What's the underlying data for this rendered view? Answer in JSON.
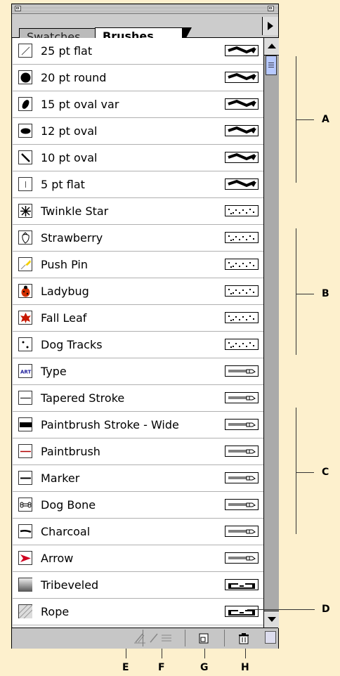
{
  "tabs": [
    {
      "label": "Swatches",
      "active": false
    },
    {
      "label": "Brushes",
      "active": true
    }
  ],
  "brushes": [
    {
      "name": "25 pt flat",
      "type": "calligraphic",
      "icon": "thin-diagonal-stroke-icon"
    },
    {
      "name": "20 pt round",
      "type": "calligraphic",
      "icon": "round-tip-icon"
    },
    {
      "name": "15 pt oval var",
      "type": "calligraphic",
      "icon": "oval-tilted-tip-icon"
    },
    {
      "name": "12 pt oval",
      "type": "calligraphic",
      "icon": "oval-tip-icon"
    },
    {
      "name": "10 pt oval",
      "type": "calligraphic",
      "icon": "diagonal-stroke-icon"
    },
    {
      "name": "5 pt flat",
      "type": "calligraphic",
      "icon": "flat-tip-icon"
    },
    {
      "name": "Twinkle Star",
      "type": "scatter",
      "icon": "star-icon"
    },
    {
      "name": "Strawberry",
      "type": "scatter",
      "icon": "strawberry-icon"
    },
    {
      "name": "Push Pin",
      "type": "scatter",
      "icon": "push-pin-icon"
    },
    {
      "name": "Ladybug",
      "type": "scatter",
      "icon": "ladybug-icon"
    },
    {
      "name": "Fall Leaf",
      "type": "scatter",
      "icon": "leaf-icon"
    },
    {
      "name": "Dog Tracks",
      "type": "scatter",
      "icon": "paw-print-icon"
    },
    {
      "name": "Type",
      "type": "art",
      "icon": "art-text-icon"
    },
    {
      "name": "Tapered Stroke",
      "type": "art",
      "icon": "tapered-stroke-icon"
    },
    {
      "name": "Paintbrush Stroke - Wide",
      "type": "art",
      "icon": "wide-stroke-icon"
    },
    {
      "name": "Paintbrush",
      "type": "art",
      "icon": "paintbrush-stroke-icon"
    },
    {
      "name": "Marker",
      "type": "art",
      "icon": "marker-stroke-icon"
    },
    {
      "name": "Dog Bone",
      "type": "art",
      "icon": "dog-bone-icon"
    },
    {
      "name": "Charcoal",
      "type": "art",
      "icon": "charcoal-stroke-icon"
    },
    {
      "name": "Arrow",
      "type": "art",
      "icon": "arrow-icon"
    },
    {
      "name": "Tribeveled",
      "type": "pattern",
      "icon": "gradient-swatch-icon"
    },
    {
      "name": "Rope",
      "type": "pattern",
      "icon": "rope-pattern-icon"
    }
  ],
  "callouts": [
    "A",
    "B",
    "C",
    "D",
    "E",
    "F",
    "G",
    "H"
  ],
  "bottom_buttons": [
    "remove-brush-stroke-icon",
    "brush-options-icon",
    "new-brush-icon",
    "trash-icon"
  ],
  "colors": {
    "background": "#fdf0cd",
    "panel": "#cccccc",
    "scroll_thumb": "#b7c9ff"
  }
}
